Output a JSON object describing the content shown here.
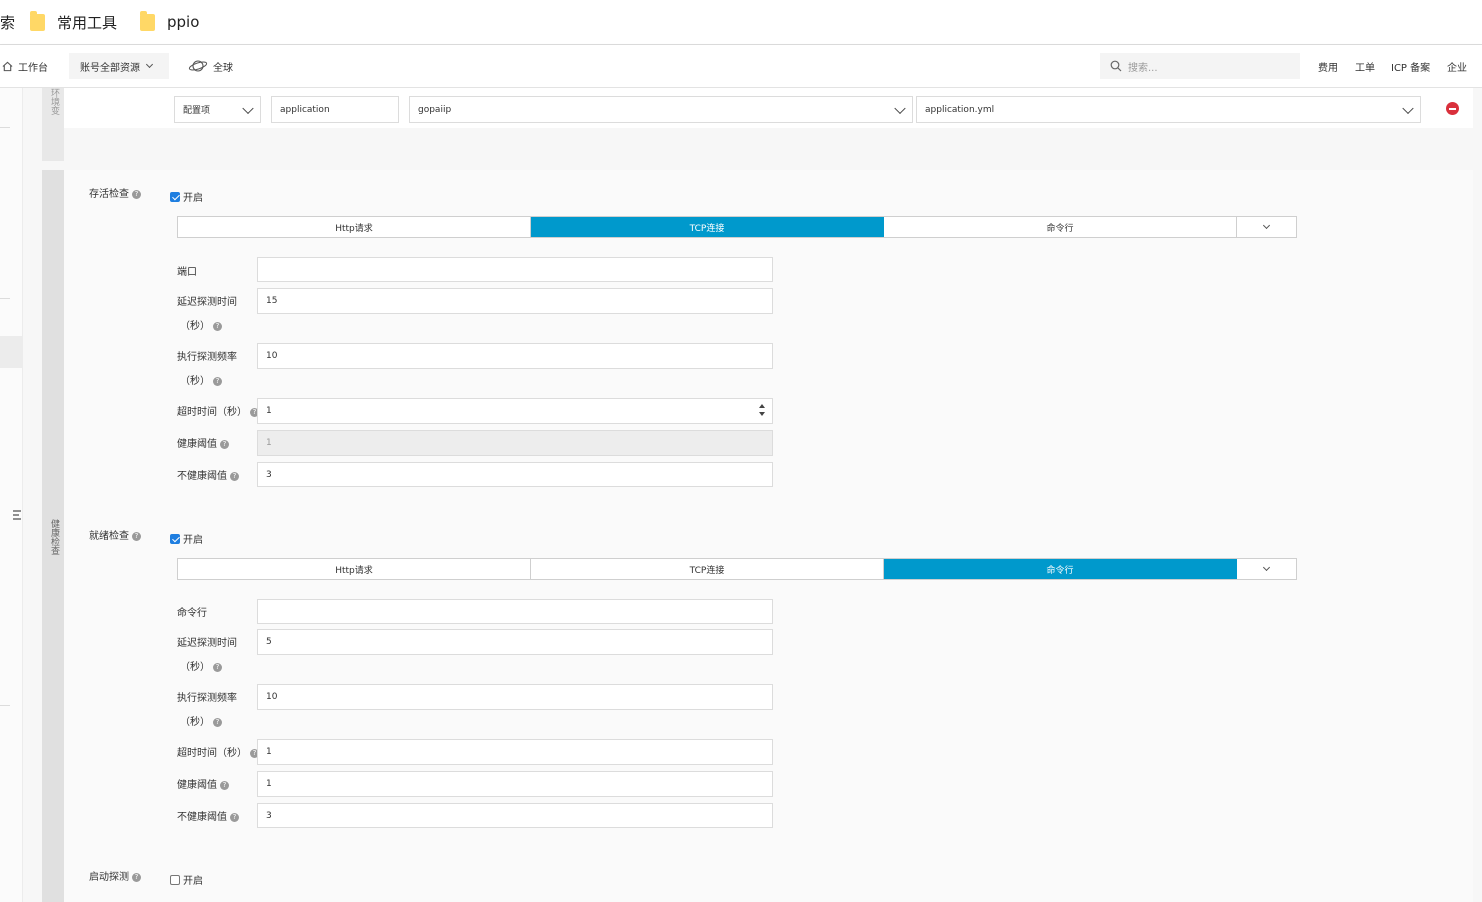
{
  "bookmarks": {
    "cut_label": "索",
    "items": [
      {
        "label": "常用工具"
      },
      {
        "label": "ppio"
      }
    ]
  },
  "topbar": {
    "workbench": "工作台",
    "account_scope": "账号全部资源",
    "region": "全球",
    "search_placeholder": "搜索...",
    "links": [
      "费用",
      "工单",
      "ICP 备案",
      "企业"
    ]
  },
  "env_section": {
    "side_label": "环境变",
    "row": {
      "type_value": "配置项",
      "name_value": "application",
      "config_value": "gopaiip",
      "file_value": "application.yml"
    }
  },
  "health_section": {
    "side_label": "健康检查",
    "liveness": {
      "title": "存活检查",
      "enabled_label": "开启",
      "enabled": true,
      "tabs": [
        "Http请求",
        "TCP连接",
        "命令行"
      ],
      "active_tab": 1,
      "fields": {
        "port_label": "端口",
        "port_value": "",
        "delay_label": "延迟探测时间",
        "delay_unit": "（秒）",
        "delay_value": "15",
        "period_label": "执行探测频率",
        "period_unit": "（秒）",
        "period_value": "10",
        "timeout_label": "超时时间（秒）",
        "timeout_value": "1",
        "healthy_label": "健康阈值",
        "healthy_value": "1",
        "unhealthy_label": "不健康阈值",
        "unhealthy_value": "3"
      }
    },
    "readiness": {
      "title": "就绪检查",
      "enabled_label": "开启",
      "enabled": true,
      "tabs": [
        "Http请求",
        "TCP连接",
        "命令行"
      ],
      "active_tab": 2,
      "fields": {
        "cmd_label": "命令行",
        "cmd_value": "",
        "delay_label": "延迟探测时间",
        "delay_unit": "（秒）",
        "delay_value": "5",
        "period_label": "执行探测频率",
        "period_unit": "（秒）",
        "period_value": "10",
        "timeout_label": "超时时间（秒）",
        "timeout_value": "1",
        "healthy_label": "健康阈值",
        "healthy_value": "1",
        "unhealthy_label": "不健康阈值",
        "unhealthy_value": "3"
      }
    },
    "startup": {
      "title": "启动探测",
      "enabled_label": "开启",
      "enabled": false
    }
  },
  "colors": {
    "active_tab": "#0099cc",
    "remove_button": "#d9303c",
    "checkbox_checked": "#1e7ee0"
  }
}
